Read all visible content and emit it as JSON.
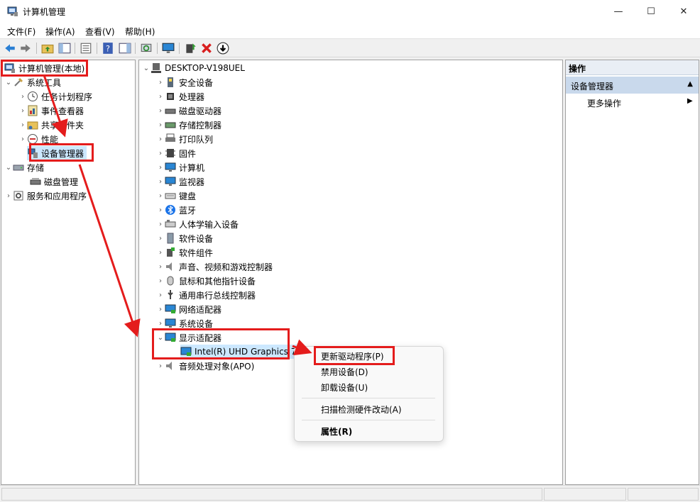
{
  "window": {
    "title": "计算机管理",
    "minimize": "—",
    "maximize": "☐",
    "close": "✕"
  },
  "menu": [
    "文件(F)",
    "操作(A)",
    "查看(V)",
    "帮助(H)"
  ],
  "toolbar": [
    "back-arrow-icon",
    "forward-arrow-icon",
    "up-folder-icon",
    "show-hide-tree-icon",
    "properties-icon",
    "help-icon",
    "action-pane-icon",
    "refresh-icon",
    "monitor-icon",
    "update-driver-icon",
    "uninstall-icon",
    "disable-device-icon"
  ],
  "left_tree": {
    "root": "计算机管理(本地)",
    "system_tools": "系统工具",
    "task_scheduler": "任务计划程序",
    "event_viewer": "事件查看器",
    "shared_folders": "共享文件夹",
    "performance": "性能",
    "device_manager": "设备管理器",
    "storage": "存储",
    "disk_management": "磁盘管理",
    "services_apps": "服务和应用程序"
  },
  "device_tree": {
    "computer": "DESKTOP-V198UEL",
    "items": [
      {
        "label": "安全设备",
        "icon": "security-device-icon"
      },
      {
        "label": "处理器",
        "icon": "processor-icon"
      },
      {
        "label": "磁盘驱动器",
        "icon": "disk-drive-icon"
      },
      {
        "label": "存储控制器",
        "icon": "storage-controller-icon"
      },
      {
        "label": "打印队列",
        "icon": "printer-icon"
      },
      {
        "label": "固件",
        "icon": "firmware-icon"
      },
      {
        "label": "计算机",
        "icon": "computer-icon"
      },
      {
        "label": "监视器",
        "icon": "monitor-icon"
      },
      {
        "label": "键盘",
        "icon": "keyboard-icon"
      },
      {
        "label": "蓝牙",
        "icon": "bluetooth-icon"
      },
      {
        "label": "人体学输入设备",
        "icon": "hid-icon"
      },
      {
        "label": "软件设备",
        "icon": "software-device-icon"
      },
      {
        "label": "软件组件",
        "icon": "software-component-icon"
      },
      {
        "label": "声音、视频和游戏控制器",
        "icon": "speaker-icon"
      },
      {
        "label": "鼠标和其他指针设备",
        "icon": "mouse-icon"
      },
      {
        "label": "通用串行总线控制器",
        "icon": "usb-icon"
      },
      {
        "label": "网络适配器",
        "icon": "network-adapter-icon"
      },
      {
        "label": "系统设备",
        "icon": "system-device-icon"
      }
    ],
    "display_adapters": "显示适配器",
    "display_child": "Intel(R) UHD Graphics 7",
    "audio_processing": "音频处理对象(APO)"
  },
  "actions": {
    "header": "操作",
    "section": "设备管理器",
    "more": "更多操作"
  },
  "context_menu": {
    "update_driver": "更新驱动程序(P)",
    "disable": "禁用设备(D)",
    "uninstall": "卸载设备(U)",
    "scan": "扫描检测硬件改动(A)",
    "properties": "属性(R)"
  },
  "colors": {
    "annotation": "#e41c1c",
    "selection": "#cce8ff",
    "action_section": "#c9d9ec"
  }
}
